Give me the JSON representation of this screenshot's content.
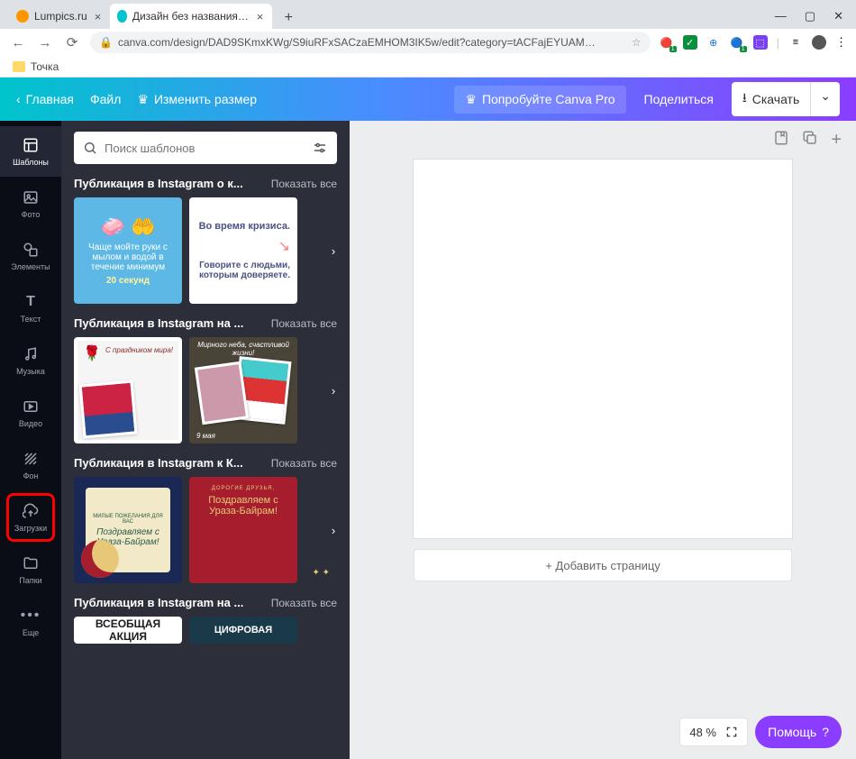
{
  "browser": {
    "tabs": [
      {
        "title": "Lumpics.ru",
        "favicon": "#ff9800"
      },
      {
        "title": "Дизайн без названия — Пост в",
        "favicon": "#00c4cc"
      }
    ],
    "url": "canva.com/design/DAD9SKmxKWg/S9iuRFxSACzaEMHOM3IK5w/edit?category=tACFajEYUAM…",
    "bookmark": "Точка"
  },
  "toolbar": {
    "home": "Главная",
    "file": "Файл",
    "resize": "Изменить размер",
    "pro": "Попробуйте Canva Pro",
    "share": "Поделиться",
    "download": "Скачать"
  },
  "rail": [
    {
      "id": "templates",
      "label": "Шаблоны"
    },
    {
      "id": "photo",
      "label": "Фото"
    },
    {
      "id": "elements",
      "label": "Элементы"
    },
    {
      "id": "text",
      "label": "Текст"
    },
    {
      "id": "music",
      "label": "Музыка"
    },
    {
      "id": "video",
      "label": "Видео"
    },
    {
      "id": "background",
      "label": "Фон"
    },
    {
      "id": "uploads",
      "label": "Загрузки"
    },
    {
      "id": "folders",
      "label": "Папки"
    },
    {
      "id": "more",
      "label": "Еще"
    }
  ],
  "search": {
    "placeholder": "Поиск шаблонов"
  },
  "sections": [
    {
      "title": "Публикация в Instagram о к...",
      "show_all": "Показать все"
    },
    {
      "title": "Публикация в Instagram на ...",
      "show_all": "Показать все"
    },
    {
      "title": "Публикация в Instagram к К...",
      "show_all": "Показать все"
    },
    {
      "title": "Публикация в Instagram на ...",
      "show_all": "Показать все"
    }
  ],
  "thumb_texts": {
    "wash": "Чаще мойте руки с мылом и водой в течение минимум",
    "wash_sec": "20 секунд",
    "crisis": "Во время кризиса.",
    "crisis2": "Говорите с людьми, которым доверяете.",
    "may1": "С праздником мира!",
    "may2": "Мирного неба, счастливой жизни!",
    "may_date": "9 мая",
    "uraza1": "Поздравляем с Ураза-Байрам!",
    "uraza2": "Поздравляем с Ураза-Байрам!",
    "uraza2_sub": "ДОРОГИЕ ДРУЗЬЯ,",
    "action": "ВСЕОБЩАЯ АКЦИЯ",
    "digital": "ЦИФРОВАЯ"
  },
  "canvas": {
    "add_page": "+ Добавить страницу",
    "zoom": "48 %",
    "help": "Помощь"
  }
}
